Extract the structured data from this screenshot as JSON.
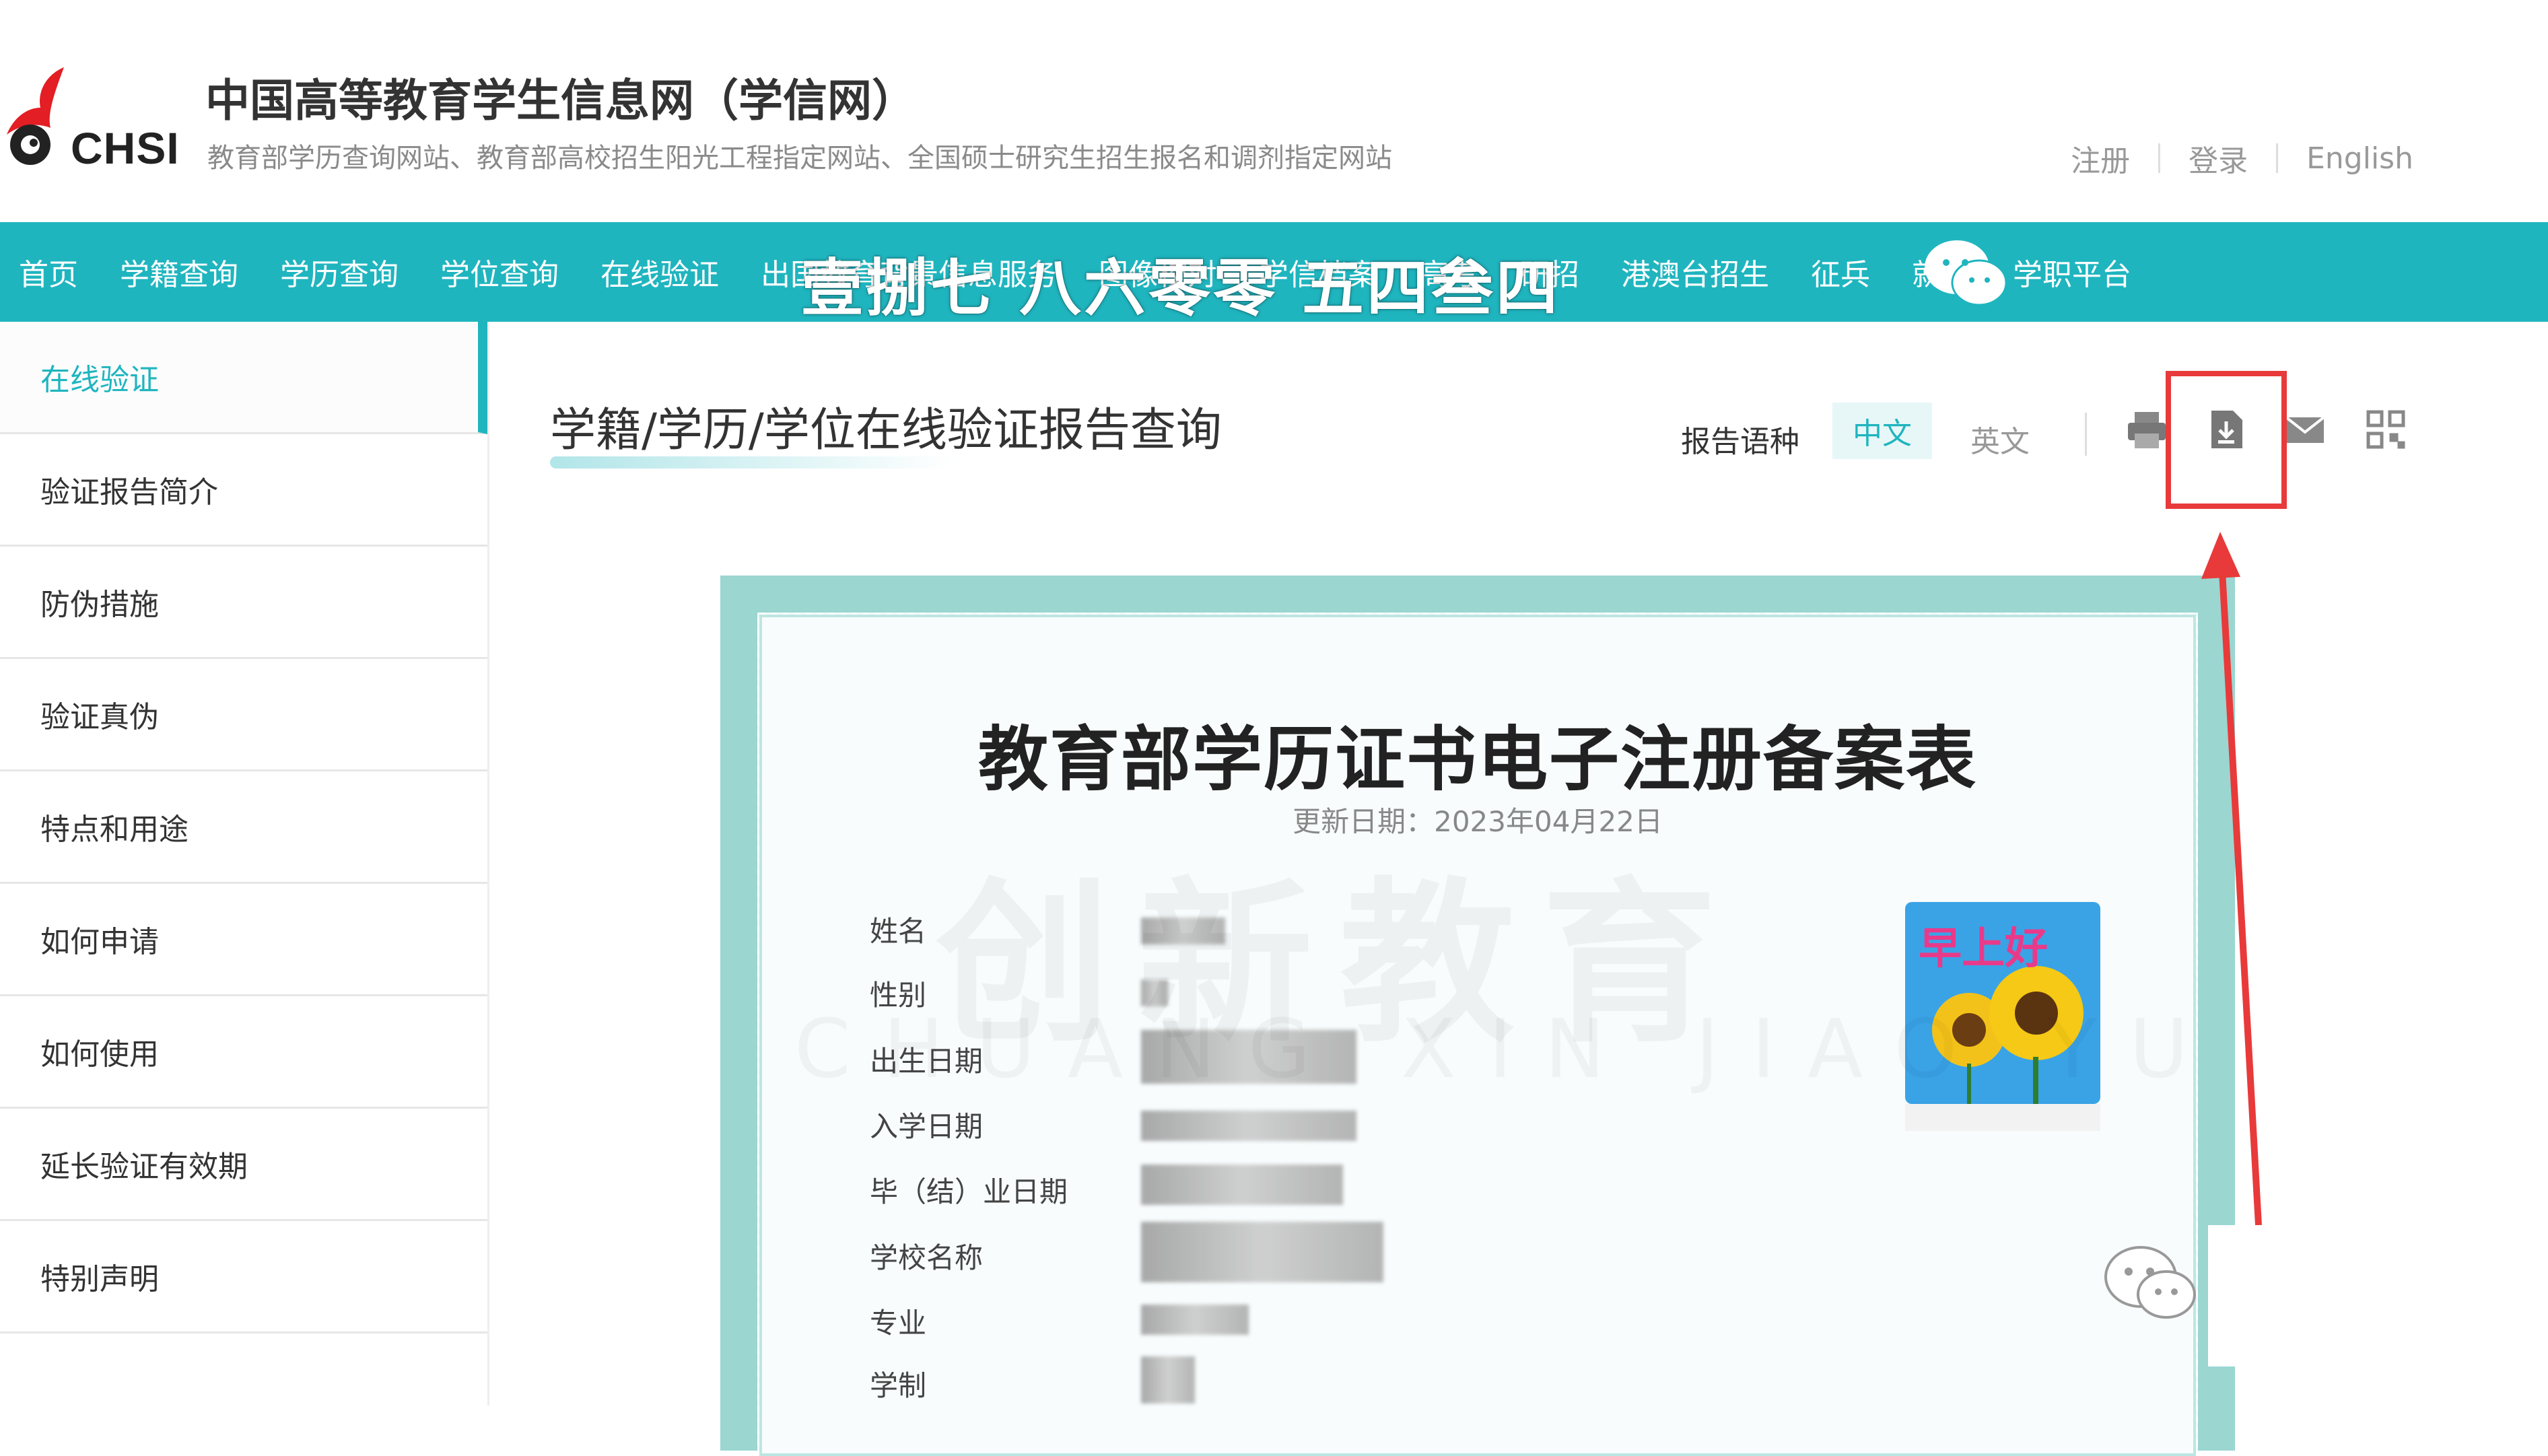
{
  "header": {
    "logo_text": "CHSI",
    "site_title": "中国高等教育学生信息网（学信网）",
    "site_subtitle": "教育部学历查询网站、教育部高校招生阳光工程指定网站、全国硕士研究生招生报名和调剂指定网站",
    "links": {
      "register": "注册",
      "login": "登录",
      "english": "English"
    }
  },
  "nav": {
    "items": [
      "首页",
      "学籍查询",
      "学历查询",
      "学位查询",
      "在线验证",
      "出国教育背景信息服务",
      "图像校对",
      "学信档案",
      "高考",
      "研招",
      "港澳台招生",
      "征兵",
      "就业",
      "学职平台"
    ],
    "overlay_text": "壹捌七 八六零零 五四叁四"
  },
  "sidebar": {
    "items": [
      "在线验证",
      "验证报告简介",
      "防伪措施",
      "验证真伪",
      "特点和用途",
      "如何申请",
      "如何使用",
      "延长验证有效期",
      "特别声明"
    ]
  },
  "main": {
    "title": "学籍/学历/学位在线验证报告查询",
    "lang_label": "报告语种",
    "lang_cn": "中文",
    "lang_en": "英文",
    "icons": [
      "print-icon",
      "download-icon",
      "mail-icon",
      "qrcode-icon"
    ]
  },
  "certificate": {
    "title": "教育部学历证书电子注册备案表",
    "update_date": "更新日期：2023年04月22日",
    "fields": [
      "姓名",
      "性别",
      "出生日期",
      "入学日期",
      "毕（结）业日期",
      "学校名称",
      "专业",
      "学制"
    ],
    "photo_text": "早上好",
    "watermark": "创新教育",
    "watermark_pinyin": "CHUANG XIN JIAO YU"
  },
  "colors": {
    "brand": "#1fb5bf",
    "highlight": "#e83a3a"
  }
}
